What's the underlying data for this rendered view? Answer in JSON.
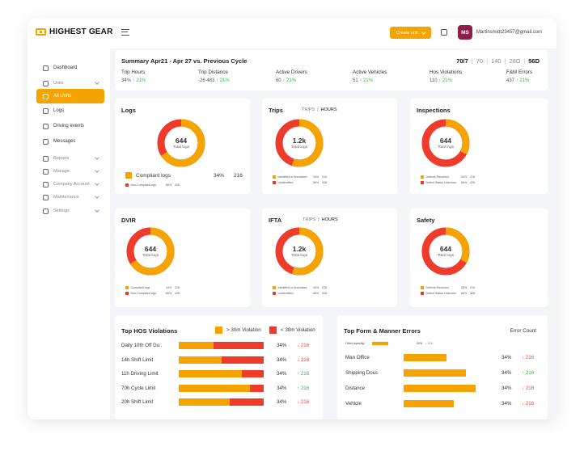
{
  "app": {
    "name": "HIGHEST GEAR",
    "create_label": "Create unit",
    "avatar_initials": "MS",
    "email": "Martinsmidt23457@gmail.com"
  },
  "colors": {
    "orange": "#f5a300",
    "red": "#ef3b2c",
    "green": "#3bb54a",
    "avatar": "#8e1d4a"
  },
  "sidebar": [
    {
      "label": "Dashboard",
      "type": "item",
      "icon": "home-icon"
    },
    {
      "label": "Units",
      "type": "section",
      "icon": "truck-icon"
    },
    {
      "label": "All Units",
      "type": "active",
      "icon": "truck-icon"
    },
    {
      "label": "Logs",
      "type": "item",
      "icon": "clock-icon"
    },
    {
      "label": "Driving events",
      "type": "item",
      "icon": "steering-icon"
    },
    {
      "label": "Messages",
      "type": "item",
      "icon": "chat-icon"
    },
    {
      "label": "Reports",
      "type": "section",
      "icon": "report-icon"
    },
    {
      "label": "Manage",
      "type": "section",
      "icon": "manage-icon"
    },
    {
      "label": "Company Account",
      "type": "section",
      "icon": "user-icon"
    },
    {
      "label": "Maintenance",
      "type": "section",
      "icon": "wrench-icon"
    },
    {
      "label": "Settings",
      "type": "section",
      "icon": "gear-icon"
    }
  ],
  "summary": {
    "title": "Summary Apr21 - Apr 27 vs. Previous Cycle",
    "ranges": [
      "70/7",
      "70",
      "140",
      "28D",
      "56D"
    ],
    "selected_ranges": [
      "70/7",
      "56D"
    ],
    "metrics": [
      {
        "label": "Trip Hours",
        "value": "34%",
        "change": "21%"
      },
      {
        "label": "Trip Distance",
        "value": "-26 483",
        "change": "21%"
      },
      {
        "label": "Active Drivers",
        "value": "60",
        "change": "21%"
      },
      {
        "label": "Active Vehicles",
        "value": "51",
        "change": "21%"
      },
      {
        "label": "Hos Violations",
        "value": "110",
        "change": "21%"
      },
      {
        "label": "F&M Errors",
        "value": "437",
        "change": "21%"
      }
    ]
  },
  "donut_cards": [
    {
      "title": "Logs",
      "tabs": [],
      "center_value": "644",
      "center_label": "Total logs",
      "share": 0.66,
      "primary": "orange",
      "big_legend": {
        "label": "Compliant logs",
        "pct": "34%",
        "count": "216"
      },
      "legend": [
        {
          "label": "Non-Compliant logs",
          "pct": "66%",
          "count": "428",
          "color": "red"
        }
      ]
    },
    {
      "title": "Trips",
      "tabs": [
        "TRIPS",
        "HOURS"
      ],
      "center_value": "1.2k",
      "center_label": "Total logs",
      "share": 0.55,
      "primary": "orange",
      "legend": [
        {
          "label": "Identified or Annotated",
          "pct": "34%",
          "count": "216",
          "color": "orange"
        },
        {
          "label": "Unidentified",
          "pct": "66%",
          "count": "428",
          "color": "red"
        }
      ]
    },
    {
      "title": "Inspections",
      "tabs": [],
      "center_value": "644",
      "center_label": "Total logs",
      "share": 0.33,
      "primary": "orange",
      "legend": [
        {
          "label": "Defects Resolved",
          "pct": "34%",
          "count": "216",
          "color": "orange"
        },
        {
          "label": "Defect Status Unknown",
          "pct": "66%",
          "count": "428",
          "color": "red"
        }
      ]
    },
    {
      "title": "DVIR",
      "tabs": [],
      "center_value": "644",
      "center_label": "Total logs",
      "share": 0.66,
      "primary": "orange",
      "legend": [
        {
          "label": "Compliant logs",
          "pct": "34%",
          "count": "216",
          "color": "orange"
        },
        {
          "label": "Non-Compliant logs",
          "pct": "66%",
          "count": "428",
          "color": "red"
        }
      ]
    },
    {
      "title": "IFTA",
      "tabs": [
        "TRIPS",
        "HOURS"
      ],
      "center_value": "1.2k",
      "center_label": "Total logs",
      "share": 0.55,
      "primary": "orange",
      "legend": [
        {
          "label": "Identified or Annotated",
          "pct": "34%",
          "count": "216",
          "color": "orange"
        },
        {
          "label": "Unidentified",
          "pct": "66%",
          "count": "428",
          "color": "red"
        }
      ]
    },
    {
      "title": "Safety",
      "tabs": [],
      "center_value": "644",
      "center_label": "Total logs",
      "share": 0.33,
      "primary": "orange",
      "legend": [
        {
          "label": "Defects Resolved",
          "pct": "34%",
          "count": "216",
          "color": "orange"
        },
        {
          "label": "Defect Status Unknown",
          "pct": "66%",
          "count": "428",
          "color": "red"
        }
      ]
    }
  ],
  "hos": {
    "title": "Top HOS Violations",
    "legend": [
      {
        "label": "> 30m Violation",
        "color": "orange"
      },
      {
        "label": "< 30m Violation",
        "color": "red"
      }
    ],
    "rows": [
      {
        "label": "Daily 10th Off Du..",
        "orange": 0.41,
        "pct": "34%",
        "change": "216",
        "dir": "down"
      },
      {
        "label": "14h Shift Limit",
        "orange": 0.5,
        "pct": "34%",
        "change": "216",
        "dir": "down"
      },
      {
        "label": "11h Driving Limit",
        "orange": 0.74,
        "pct": "34%",
        "change": "216",
        "dir": "up"
      },
      {
        "label": "70h Cycle Limit",
        "orange": 0.84,
        "pct": "34%",
        "change": "216",
        "dir": "up"
      },
      {
        "label": "20h Shift Limit",
        "orange": 0.6,
        "pct": "34%",
        "change": "216",
        "dir": "down"
      }
    ]
  },
  "fm": {
    "title": "Top Form & Manner Errors",
    "error_count_label": "Error Count",
    "rows": [
      {
        "label": "Other (specify)",
        "value": 0.22,
        "pct": "34%",
        "change": "216",
        "dir": "down",
        "small": true
      },
      {
        "label": "Man Office",
        "value": 0.59,
        "pct": "34%",
        "change": "216",
        "dir": "down"
      },
      {
        "label": "Shipping Docs",
        "value": 0.87,
        "pct": "34%",
        "change": "216",
        "dir": "up"
      },
      {
        "label": "Distance",
        "value": 1.0,
        "pct": "34%",
        "change": "216",
        "dir": "down"
      },
      {
        "label": "Vehicle",
        "value": 0.7,
        "pct": "34%",
        "change": "216",
        "dir": "down"
      }
    ]
  }
}
